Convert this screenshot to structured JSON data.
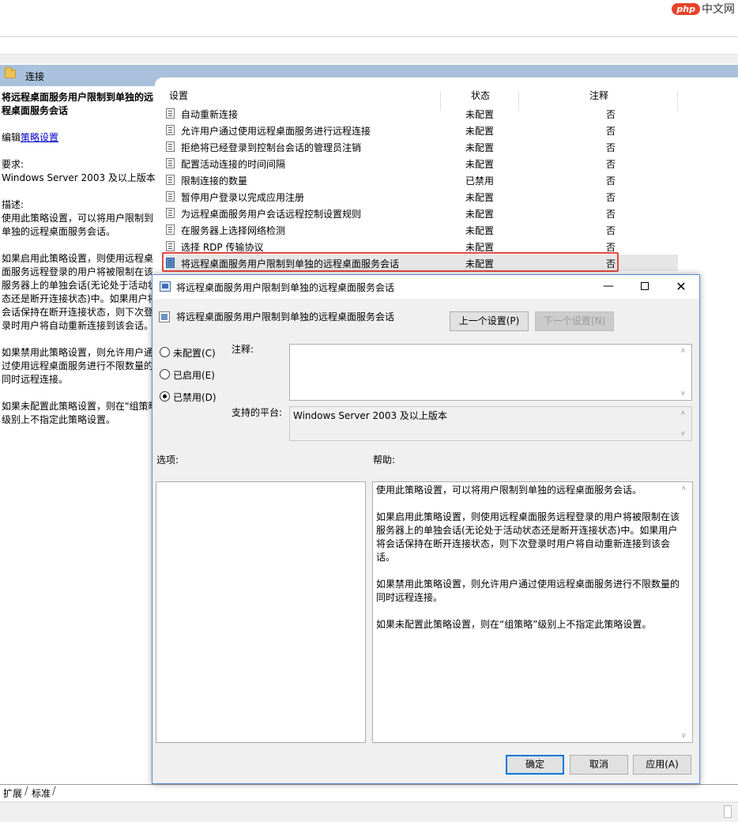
{
  "site": {
    "logo_php": "php",
    "logo_cn": "中文网"
  },
  "header": {
    "folder_title": "连接"
  },
  "description": {
    "title_line1": "将远程桌面服务用户限制到单独的远",
    "title_line2": "程桌面服务会话",
    "edit_prefix": "编辑",
    "edit_link": "策略设置",
    "requirements_label": "要求:",
    "requirements_value": "Windows Server 2003 及以上版本",
    "desc_label": "描述:",
    "desc_lines1": [
      "使用此策略设置，可以将用户限制到",
      "单独的远程桌面服务会话。"
    ],
    "desc_lines2": [
      "如果启用此策略设置，则使用远程桌",
      "面服务远程登录的用户将被限制在该",
      "服务器上的单独会话(无论处于活动状",
      "态还是断开连接状态)中。如果用户将",
      "会话保持在断开连接状态，则下次登",
      "录时用户将自动重新连接到该会话。"
    ],
    "desc_lines3": [
      "如果禁用此策略设置，则允许用户通",
      "过使用远程桌面服务进行不限数量的",
      "同时远程连接。"
    ],
    "desc_lines4": [
      "如果未配置此策略设置，则在\"组策略",
      "级别上不指定此策略设置。"
    ]
  },
  "list": {
    "col_setting": "设置",
    "col_state": "状态",
    "col_note": "注释",
    "rows": [
      {
        "name": "自动重新连接",
        "state": "未配置",
        "note": "否"
      },
      {
        "name": "允许用户通过使用远程桌面服务进行远程连接",
        "state": "未配置",
        "note": "否"
      },
      {
        "name": "拒绝将已经登录到控制台会话的管理员注销",
        "state": "未配置",
        "note": "否"
      },
      {
        "name": "配置活动连接的时间间隔",
        "state": "未配置",
        "note": "否"
      },
      {
        "name": "限制连接的数量",
        "state": "已禁用",
        "note": "否"
      },
      {
        "name": "暂停用户登录以完成应用注册",
        "state": "未配置",
        "note": "否"
      },
      {
        "name": "为远程桌面服务用户会话远程控制设置规则",
        "state": "未配置",
        "note": "否"
      },
      {
        "name": "在服务器上选择网络检测",
        "state": "未配置",
        "note": "否"
      },
      {
        "name": "选择 RDP 传输协议",
        "state": "未配置",
        "note": "否"
      },
      {
        "name": "将远程桌面服务用户限制到单独的远程桌面服务会话",
        "state": "未配置",
        "note": "否"
      }
    ]
  },
  "tabs": {
    "expand": "扩展",
    "standard": "标准"
  },
  "dialog": {
    "title": "将远程桌面服务用户限制到单独的远程桌面服务会话",
    "subtitle": "将远程桌面服务用户限制到单独的远程桌面服务会话",
    "prev_button": "上一个设置(P)",
    "next_button": "下一个设置(N)",
    "radio_not_configured": "未配置(C)",
    "radio_enabled": "已启用(E)",
    "radio_disabled": "已禁用(D)",
    "selected_option": "disabled",
    "comment_label": "注释:",
    "comment_value": "",
    "platform_label": "支持的平台:",
    "platform_value": "Windows Server 2003 及以上版本",
    "options_label": "选项:",
    "help_label": "帮助:",
    "help_paragraphs": [
      "使用此策略设置，可以将用户限制到单独的远程桌面服务会话。",
      "如果启用此策略设置，则使用远程桌面服务远程登录的用户将被限制在该服务器上的单独会话(无论处于活动状态还是断开连接状态)中。如果用户将会话保持在断开连接状态，则下次登录时用户将自动重新连接到该会话。",
      "如果禁用此策略设置，则允许用户通过使用远程桌面服务进行不限数量的同时远程连接。",
      "如果未配置此策略设置，则在“组策略”级别上不指定此策略设置。"
    ],
    "ok_button": "确定",
    "cancel_button": "取消",
    "apply_button": "应用(A)"
  },
  "colors": {
    "band": "#a9c1dc",
    "highlight_border": "#e2483c",
    "dialog_border": "#5b8ad6",
    "link": "#0000cc"
  }
}
